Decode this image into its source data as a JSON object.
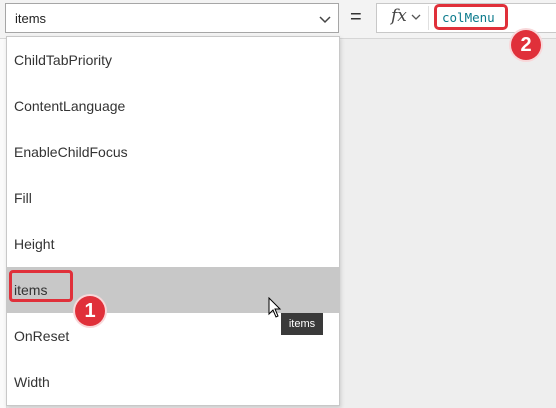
{
  "property_selector": {
    "value": "items"
  },
  "equals": "=",
  "formula_bar": {
    "fx": "fx",
    "value": "colMenu"
  },
  "dropdown": {
    "items": [
      {
        "label": "ChildTabPriority",
        "selected": false
      },
      {
        "label": "ContentLanguage",
        "selected": false
      },
      {
        "label": "EnableChildFocus",
        "selected": false
      },
      {
        "label": "Fill",
        "selected": false
      },
      {
        "label": "Height",
        "selected": false
      },
      {
        "label": "items",
        "selected": true
      },
      {
        "label": "OnReset",
        "selected": false
      },
      {
        "label": "Width",
        "selected": false
      }
    ]
  },
  "tooltip": "items",
  "badges": {
    "first": "1",
    "second": "2"
  },
  "colors": {
    "highlight": "#e0303a",
    "formula_text": "#0b7a8c",
    "selected_row": "#c8c8c8"
  }
}
